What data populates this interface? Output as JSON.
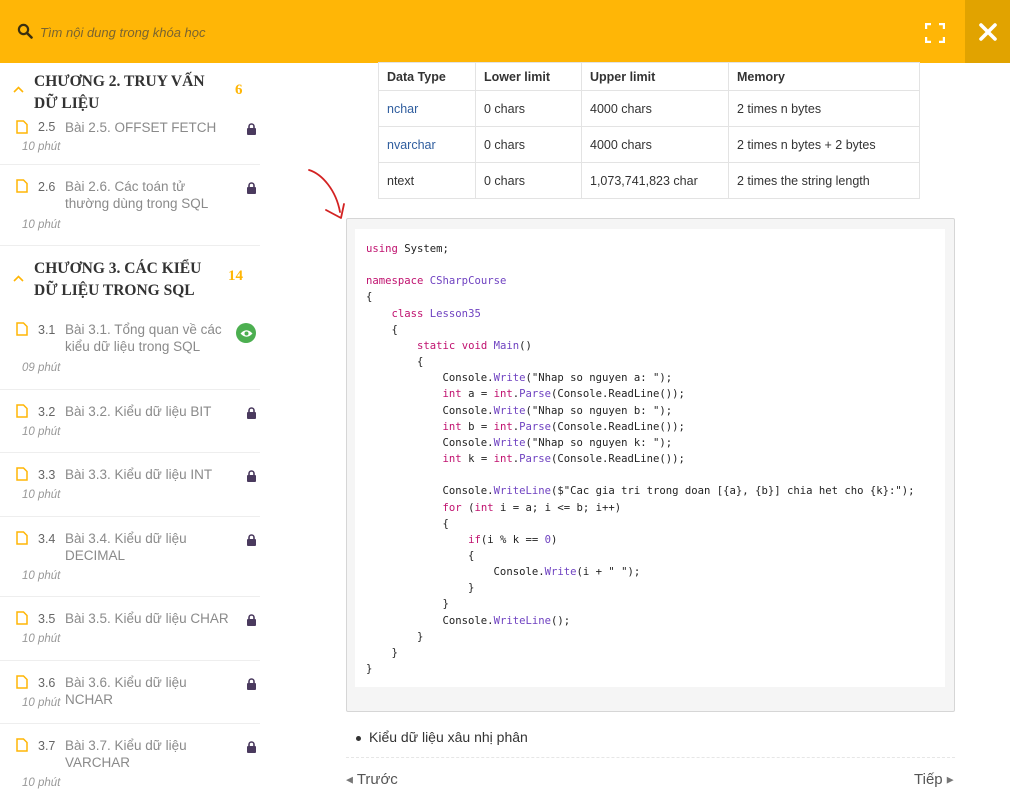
{
  "search": {
    "placeholder": "Tìm nội dung trong khóa học"
  },
  "colors": {
    "accent": "#ffb606",
    "lock": "#4a3a5e",
    "eye": "#4caf50",
    "link": "#2f5d9e"
  },
  "sidebar": {
    "chapters": [
      {
        "title": "CHƯƠNG 2. TRUY VẤN DỮ LIỆU",
        "count": "6",
        "lessons": [
          {
            "num": "2.5",
            "title": "Bài 2.5. OFFSET FETCH",
            "duration": "10 phút",
            "status": "lock"
          },
          {
            "num": "2.6",
            "title": "Bài 2.6. Các toán tử thường dùng trong SQL",
            "duration": "10 phút",
            "status": "lock"
          }
        ]
      },
      {
        "title": "CHƯƠNG 3. CÁC KIỂU DỮ LIỆU TRONG SQL",
        "count": "14",
        "lessons": [
          {
            "num": "3.1",
            "title": "Bài 3.1. Tổng quan về các kiểu dữ liệu trong SQL",
            "duration": "09 phút",
            "status": "preview"
          },
          {
            "num": "3.2",
            "title": "Bài 3.2. Kiểu dữ liệu BIT",
            "duration": "10 phút",
            "status": "lock"
          },
          {
            "num": "3.3",
            "title": "Bài 3.3. Kiểu dữ liệu INT",
            "duration": "10 phút",
            "status": "lock"
          },
          {
            "num": "3.4",
            "title": "Bài 3.4. Kiểu dữ liệu DECIMAL",
            "duration": "10 phút",
            "status": "lock"
          },
          {
            "num": "3.5",
            "title": "Bài 3.5. Kiểu dữ liệu CHAR",
            "duration": "10 phút",
            "status": "lock"
          },
          {
            "num": "3.6",
            "title": "Bài 3.6. Kiểu dữ liệu NCHAR",
            "duration": "10 phút",
            "status": "lock"
          },
          {
            "num": "3.7",
            "title": "Bài 3.7. Kiểu dữ liệu VARCHAR",
            "duration": "10 phút",
            "status": "lock"
          }
        ]
      }
    ]
  },
  "table": {
    "headers": [
      "Data Type",
      "Lower limit",
      "Upper limit",
      "Memory"
    ],
    "rows": [
      [
        "nchar",
        "0 chars",
        "4000 chars",
        "2 times n bytes"
      ],
      [
        "nvarchar",
        "0 chars",
        "4000 chars",
        "2 times n bytes + 2 bytes"
      ],
      [
        "ntext",
        "0 chars",
        "1,073,741,823 char",
        "2 times the string length"
      ]
    ]
  },
  "code": {
    "lines": [
      "using System;",
      "",
      "namespace CSharpCourse",
      "{",
      "    class Lesson35",
      "    {",
      "        static void Main()",
      "        {",
      "            Console.Write(\"Nhap so nguyen a: \");",
      "            int a = int.Parse(Console.ReadLine());",
      "            Console.Write(\"Nhap so nguyen b: \");",
      "            int b = int.Parse(Console.ReadLine());",
      "            Console.Write(\"Nhap so nguyen k: \");",
      "            int k = int.Parse(Console.ReadLine());",
      "",
      "            Console.WriteLine($\"Cac gia tri trong doan [{a}, {b}] chia het cho {k}:\");",
      "            for (int i = a; i <= b; i++)",
      "            {",
      "                if(i % k == 0)",
      "                {",
      "                    Console.Write(i + \" \");",
      "                }",
      "            }",
      "            Console.WriteLine();",
      "        }",
      "    }",
      "}"
    ]
  },
  "bullet": "Kiểu dữ liệu xâu nhị phân",
  "nav": {
    "prev": "Trước",
    "next": "Tiếp"
  }
}
